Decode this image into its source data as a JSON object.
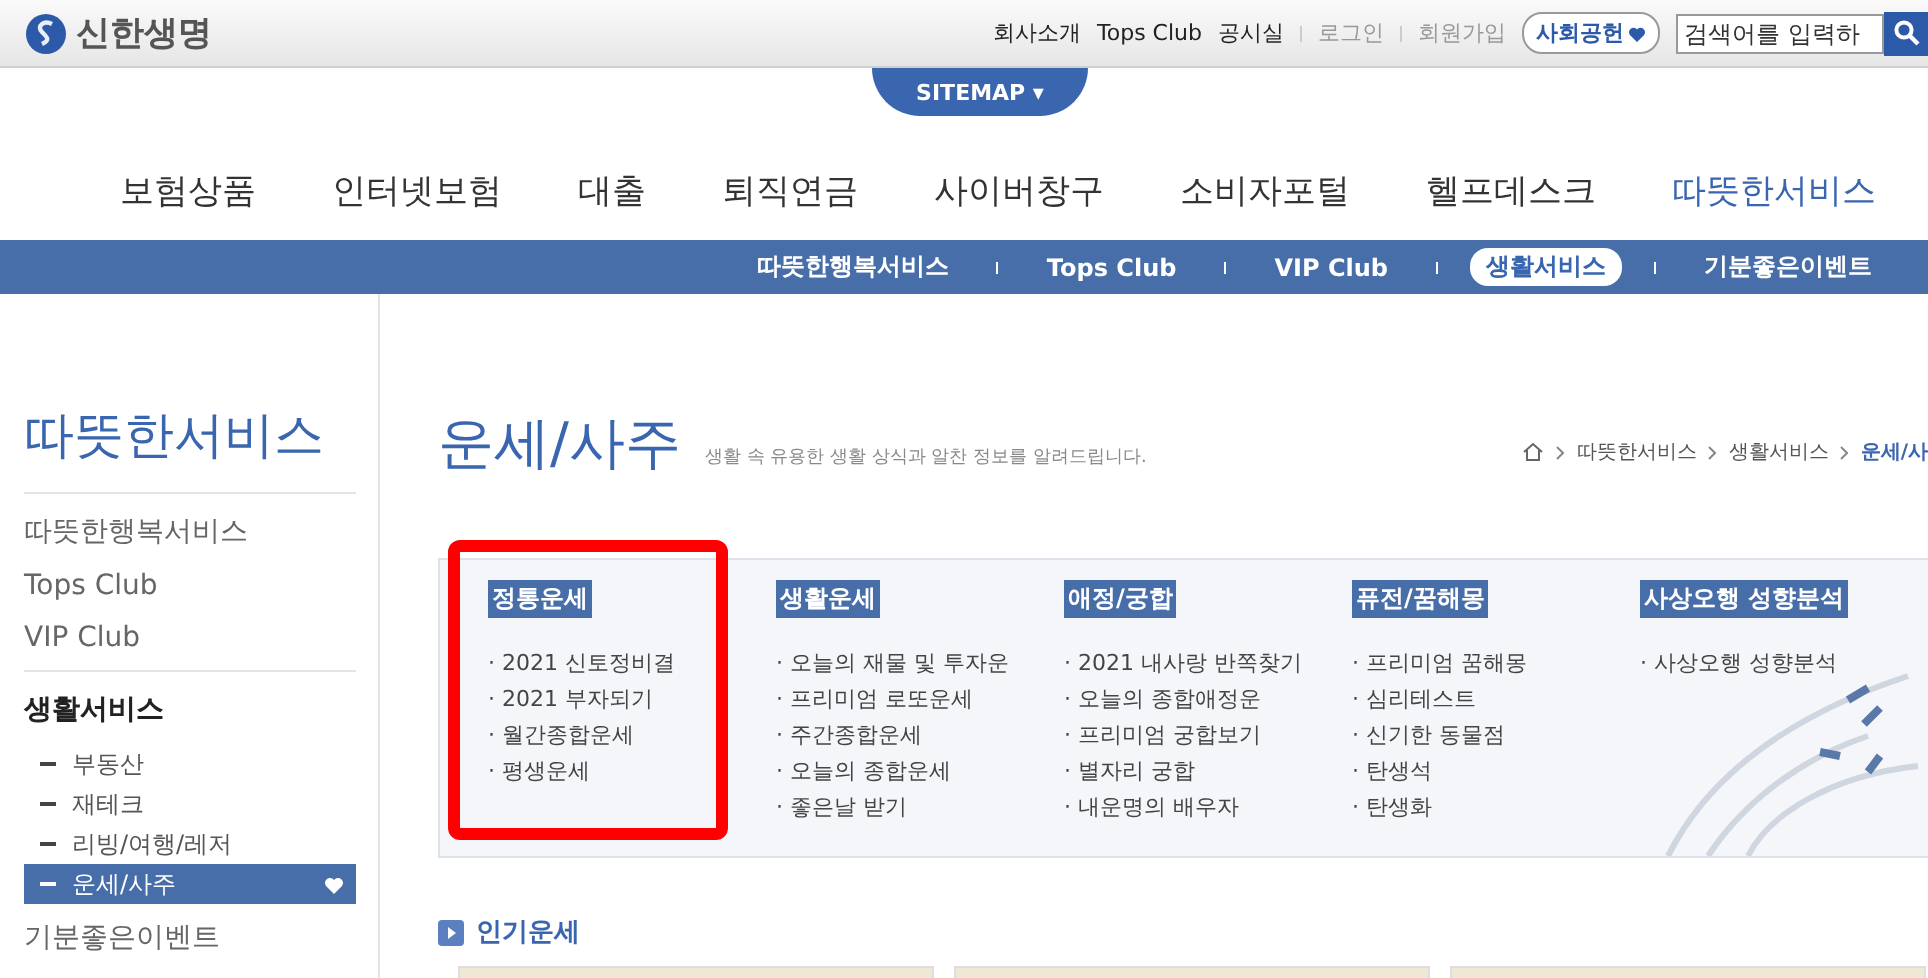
{
  "header": {
    "logo": "신한생명",
    "links": [
      {
        "label": "회사소개",
        "muted": false
      },
      {
        "label": "Tops Club",
        "muted": false
      },
      {
        "label": "공시실",
        "muted": false
      },
      {
        "label": "로그인",
        "muted": true
      },
      {
        "label": "회원가입",
        "muted": true
      }
    ],
    "social_button": "사회공헌",
    "search": {
      "placeholder": "검색어를 입력하"
    },
    "sitemap": "SITEMAP ▾"
  },
  "main_nav": [
    {
      "label": "보험상품",
      "selected": false
    },
    {
      "label": "인터넷보험",
      "selected": false
    },
    {
      "label": "대출",
      "selected": false
    },
    {
      "label": "퇴직연금",
      "selected": false
    },
    {
      "label": "사이버창구",
      "selected": false
    },
    {
      "label": "소비자포털",
      "selected": false
    },
    {
      "label": "헬프데스크",
      "selected": false
    },
    {
      "label": "따뜻한서비스",
      "selected": true
    }
  ],
  "sub_nav": [
    {
      "label": "따뜻한행복서비스",
      "selected": false
    },
    {
      "label": "Tops Club",
      "selected": false
    },
    {
      "label": "VIP Club",
      "selected": false
    },
    {
      "label": "생활서비스",
      "selected": true
    },
    {
      "label": "기분좋은이벤트",
      "selected": false
    }
  ],
  "sidebar": {
    "title": "따뜻한서비스",
    "items": [
      {
        "label": "따뜻한행복서비스",
        "selected": false
      },
      {
        "label": "Tops Club",
        "selected": false
      },
      {
        "label": "VIP Club",
        "selected": false
      },
      {
        "label": "생활서비스",
        "selected": true,
        "children": [
          {
            "label": "부동산",
            "selected": false
          },
          {
            "label": "재테크",
            "selected": false
          },
          {
            "label": "리빙/여행/레저",
            "selected": false
          },
          {
            "label": "운세/사주",
            "selected": true
          }
        ]
      },
      {
        "label": "기분좋은이벤트",
        "selected": false
      }
    ]
  },
  "page": {
    "title": "운세/사주",
    "subtitle": "생활 속 유용한 생활 상식과 알찬 정보를 알려드립니다.",
    "breadcrumb": [
      "따뜻한서비스",
      "생활서비스",
      "운세/사"
    ]
  },
  "categories": [
    {
      "title": "정통운세",
      "highlighted": true,
      "items": [
        "· 2021 신토정비결",
        "· 2021 부자되기",
        "· 월간종합운세",
        "· 평생운세"
      ]
    },
    {
      "title": "생활운세",
      "highlighted": false,
      "items": [
        "· 오늘의 재물 및 투자운",
        "· 프리미엄 로또운세",
        "· 주간종합운세",
        "· 오늘의 종합운세",
        "· 좋은날 받기"
      ]
    },
    {
      "title": "애정/궁합",
      "highlighted": false,
      "items": [
        "· 2021 내사랑 반쪽찾기",
        "· 오늘의 종합애정운",
        "· 프리미엄 궁합보기",
        "· 별자리 궁합",
        "· 내운명의 배우자"
      ]
    },
    {
      "title": "퓨전/꿈해몽",
      "highlighted": false,
      "items": [
        "· 프리미엄 꿈해몽",
        "· 심리테스트",
        "· 신기한 동물점",
        "· 탄생석",
        "· 탄생화"
      ]
    },
    {
      "title": "사상오행 성향분석",
      "highlighted": false,
      "items": [
        "· 사상오행 성향분석"
      ]
    }
  ],
  "popular": {
    "title": "인기운세"
  }
}
